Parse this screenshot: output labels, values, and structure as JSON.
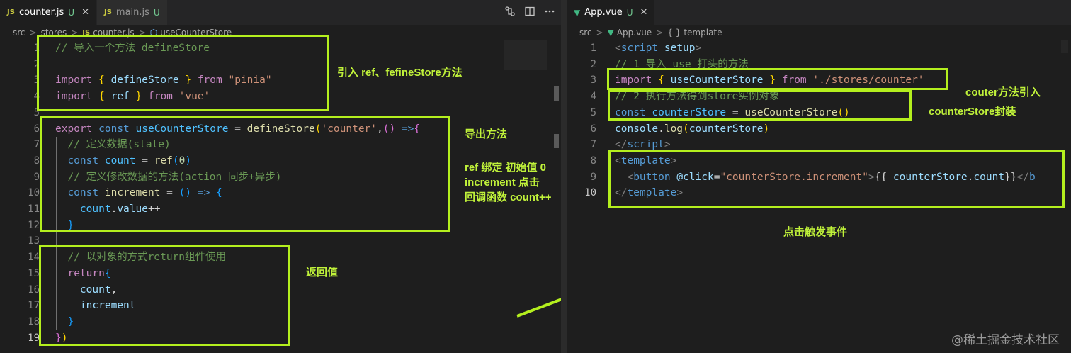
{
  "left_editor": {
    "tabs": [
      {
        "icon": "JS",
        "name": "counter.js",
        "status": "U",
        "close": "✕"
      },
      {
        "icon": "JS",
        "name": "main.js",
        "status": "U"
      }
    ],
    "breadcrumb": [
      "src",
      "stores",
      "counter.js",
      "useCounterStore"
    ],
    "breadcrumb_file_icon": "JS",
    "breadcrumb_symbol_icon": "⬡",
    "lines": [
      [
        {
          "t": "c",
          "v": "// 导入一个方法 defineStore"
        }
      ],
      [],
      [
        {
          "t": "kw",
          "v": "import"
        },
        {
          "t": "p",
          "v": " "
        },
        {
          "t": "b1",
          "v": "{"
        },
        {
          "t": "v",
          "v": " defineStore "
        },
        {
          "t": "b1",
          "v": "}"
        },
        {
          "t": "p",
          "v": " "
        },
        {
          "t": "kw",
          "v": "from"
        },
        {
          "t": "p",
          "v": " "
        },
        {
          "t": "s",
          "v": "\"pinia\""
        }
      ],
      [
        {
          "t": "kw",
          "v": "import"
        },
        {
          "t": "p",
          "v": " "
        },
        {
          "t": "b1",
          "v": "{"
        },
        {
          "t": "v",
          "v": " ref "
        },
        {
          "t": "b1",
          "v": "}"
        },
        {
          "t": "p",
          "v": " "
        },
        {
          "t": "kw",
          "v": "from"
        },
        {
          "t": "p",
          "v": " "
        },
        {
          "t": "s",
          "v": "'vue'"
        }
      ],
      [],
      [
        {
          "t": "kw",
          "v": "export"
        },
        {
          "t": "p",
          "v": " "
        },
        {
          "t": "k",
          "v": "const"
        },
        {
          "t": "p",
          "v": " "
        },
        {
          "t": "cv",
          "v": "useCounterStore"
        },
        {
          "t": "p",
          "v": " = "
        },
        {
          "t": "f",
          "v": "defineStore"
        },
        {
          "t": "b1",
          "v": "("
        },
        {
          "t": "s",
          "v": "'counter'"
        },
        {
          "t": "p",
          "v": ","
        },
        {
          "t": "b2",
          "v": "()"
        },
        {
          "t": "p",
          "v": " "
        },
        {
          "t": "k",
          "v": "=>"
        },
        {
          "t": "b2",
          "v": "{"
        }
      ],
      [
        {
          "t": "p",
          "v": "  "
        },
        {
          "t": "c",
          "v": "// 定义数据(state)"
        }
      ],
      [
        {
          "t": "p",
          "v": "  "
        },
        {
          "t": "k",
          "v": "const"
        },
        {
          "t": "p",
          "v": " "
        },
        {
          "t": "cv",
          "v": "count"
        },
        {
          "t": "p",
          "v": " = "
        },
        {
          "t": "f",
          "v": "ref"
        },
        {
          "t": "b3",
          "v": "("
        },
        {
          "t": "n",
          "v": "0"
        },
        {
          "t": "b3",
          "v": ")"
        }
      ],
      [
        {
          "t": "p",
          "v": "  "
        },
        {
          "t": "c",
          "v": "// 定义修改数据的方法(action 同步+异步)"
        }
      ],
      [
        {
          "t": "p",
          "v": "  "
        },
        {
          "t": "k",
          "v": "const"
        },
        {
          "t": "p",
          "v": " "
        },
        {
          "t": "f",
          "v": "increment"
        },
        {
          "t": "p",
          "v": " = "
        },
        {
          "t": "b3",
          "v": "()"
        },
        {
          "t": "p",
          "v": " "
        },
        {
          "t": "k",
          "v": "=>"
        },
        {
          "t": "p",
          "v": " "
        },
        {
          "t": "b3",
          "v": "{"
        }
      ],
      [
        {
          "t": "p",
          "v": "    "
        },
        {
          "t": "cv",
          "v": "count"
        },
        {
          "t": "p",
          "v": "."
        },
        {
          "t": "v",
          "v": "value"
        },
        {
          "t": "p",
          "v": "++"
        }
      ],
      [
        {
          "t": "p",
          "v": "  "
        },
        {
          "t": "b3",
          "v": "}"
        }
      ],
      [],
      [
        {
          "t": "p",
          "v": "  "
        },
        {
          "t": "c",
          "v": "// 以对象的方式return组件使用"
        }
      ],
      [
        {
          "t": "p",
          "v": "  "
        },
        {
          "t": "kw",
          "v": "return"
        },
        {
          "t": "b3",
          "v": "{"
        }
      ],
      [
        {
          "t": "p",
          "v": "    "
        },
        {
          "t": "v",
          "v": "count"
        },
        {
          "t": "p",
          "v": ","
        }
      ],
      [
        {
          "t": "p",
          "v": "    "
        },
        {
          "t": "v",
          "v": "increment"
        }
      ],
      [
        {
          "t": "p",
          "v": "  "
        },
        {
          "t": "b3",
          "v": "}"
        }
      ],
      [
        {
          "t": "b2",
          "v": "}"
        },
        {
          "t": "b1",
          "v": ")"
        }
      ]
    ],
    "annotations": [
      "引入 ref、fefineStore方法",
      "导出方法",
      "ref 绑定 初始值 0",
      "increment 点击",
      "回调函数 count++",
      "返回值"
    ]
  },
  "right_editor": {
    "tabs": [
      {
        "icon": "▼",
        "name": "App.vue",
        "status": "U",
        "close": "✕"
      }
    ],
    "breadcrumb": [
      "src",
      "App.vue",
      "template"
    ],
    "breadcrumb_file_icon": "▼",
    "breadcrumb_symbol_icon": "{ }",
    "lines": [
      [
        {
          "t": "tagp",
          "v": "<"
        },
        {
          "t": "tag",
          "v": "script"
        },
        {
          "t": "p",
          "v": " "
        },
        {
          "t": "attr",
          "v": "setup"
        },
        {
          "t": "tagp",
          "v": ">"
        }
      ],
      [
        {
          "t": "c",
          "v": "// 1 导入 use 打头的方法"
        }
      ],
      [
        {
          "t": "kw",
          "v": "import"
        },
        {
          "t": "p",
          "v": " "
        },
        {
          "t": "b1",
          "v": "{"
        },
        {
          "t": "v",
          "v": " useCounterStore "
        },
        {
          "t": "b1",
          "v": "}"
        },
        {
          "t": "p",
          "v": " "
        },
        {
          "t": "kw",
          "v": "from"
        },
        {
          "t": "p",
          "v": " "
        },
        {
          "t": "s",
          "v": "'./stores/counter'"
        }
      ],
      [
        {
          "t": "c",
          "v": "// 2 执行方法得到store实例对象"
        }
      ],
      [
        {
          "t": "k",
          "v": "const"
        },
        {
          "t": "p",
          "v": " "
        },
        {
          "t": "cv",
          "v": "counterStore"
        },
        {
          "t": "p",
          "v": " = "
        },
        {
          "t": "f",
          "v": "useCounterStore"
        },
        {
          "t": "b1",
          "v": "()"
        }
      ],
      [
        {
          "t": "v",
          "v": "console"
        },
        {
          "t": "p",
          "v": "."
        },
        {
          "t": "f",
          "v": "log"
        },
        {
          "t": "b1",
          "v": "("
        },
        {
          "t": "v",
          "v": "counterStore"
        },
        {
          "t": "b1",
          "v": ")"
        }
      ],
      [
        {
          "t": "tagp",
          "v": "</"
        },
        {
          "t": "tag",
          "v": "script"
        },
        {
          "t": "tagp",
          "v": ">"
        }
      ],
      [
        {
          "t": "tagp",
          "v": "<"
        },
        {
          "t": "tag",
          "v": "template"
        },
        {
          "t": "tagp",
          "v": ">"
        }
      ],
      [
        {
          "t": "p",
          "v": "  "
        },
        {
          "t": "tagp",
          "v": "<"
        },
        {
          "t": "tag",
          "v": "button"
        },
        {
          "t": "p",
          "v": " "
        },
        {
          "t": "attr",
          "v": "@click"
        },
        {
          "t": "p",
          "v": "="
        },
        {
          "t": "s",
          "v": "\"counterStore.increment\""
        },
        {
          "t": "tagp",
          "v": ">"
        },
        {
          "t": "p",
          "v": "{{ "
        },
        {
          "t": "v",
          "v": "counterStore"
        },
        {
          "t": "p",
          "v": "."
        },
        {
          "t": "v",
          "v": "count"
        },
        {
          "t": "p",
          "v": "}}"
        },
        {
          "t": "tagp",
          "v": "</"
        },
        {
          "t": "tag",
          "v": "b"
        }
      ],
      [
        {
          "t": "tagp",
          "v": "</"
        },
        {
          "t": "tag",
          "v": "template"
        },
        {
          "t": "tagp",
          "v": ">"
        }
      ]
    ],
    "annotations": [
      "couter方法引入",
      "counterStore封装",
      "点击触发事件"
    ]
  },
  "watermark": "@稀土掘金技术社区",
  "colors": {
    "highlight": "#b4ef1e",
    "annotation": "#c0f23a",
    "editor_bg": "#1e1e1e"
  }
}
